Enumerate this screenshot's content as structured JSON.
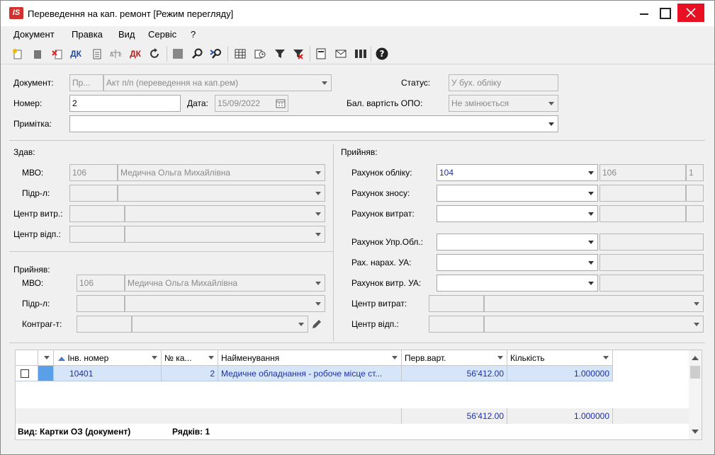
{
  "window": {
    "title": "Переведення на кап. ремонт [Режим перегляду]",
    "app_icon": "IS"
  },
  "menu": [
    "Документ",
    "Правка",
    "Вид",
    "Сервіс",
    "?"
  ],
  "form": {
    "document_label": "Документ:",
    "document_code": "Пр...",
    "document_type": "Акт п/п (переведення на кап.рем)",
    "status_label": "Статус:",
    "status_value": "У бух. обліку",
    "number_label": "Номер:",
    "number_value": "2",
    "date_label": "Дата:",
    "date_value": "15/09/2022",
    "balance_label": "Бал. вартість ОПО:",
    "balance_value": "Не змінюється",
    "note_label": "Примітка:",
    "note_value": ""
  },
  "gave": {
    "title": "Здав:",
    "mvo_label": "МВО:",
    "mvo_code": "106",
    "mvo_name": "Медична Ольга Михайлівна",
    "subdiv_label": "Підр-л:",
    "cost_center_label": "Центр витр.:",
    "resp_center_label": "Центр відп.:"
  },
  "received_left": {
    "title": "Прийняв:",
    "mvo_label": "МВО:",
    "mvo_code": "106",
    "mvo_name": "Медична Ольга Михайлівна",
    "subdiv_label": "Підр-л:",
    "contractor_label": "Контраг-т:"
  },
  "received_right": {
    "title": "Прийняв:",
    "account_label": "Рахунок обліку:",
    "account_value": "104",
    "account_code": "106",
    "account_num": "1",
    "wear_label": "Рахунок зносу:",
    "expense_label": "Рахунок витрат:",
    "mgmt_label": "Рахунок Упр.Обл.:",
    "accrual_label": "Рах. нарах. УА:",
    "exp_ua_label": "Рахунок витр. УА:",
    "cost_center_label": "Центр витрат:",
    "resp_center_label": "Центр відп.:"
  },
  "grid": {
    "columns": [
      "Інв. номер",
      "№ ка...",
      "Найменування",
      "Перв.варт.",
      "Кількість"
    ],
    "rows": [
      {
        "inv": "10401",
        "num": "2",
        "name": "Медичне обладнання - робоче місце ст...",
        "cost": "56'412.00",
        "qty": "1.000000"
      }
    ],
    "total_cost": "56'412.00",
    "total_qty": "1.000000",
    "view_label": "Вид: Картки ОЗ (документ)",
    "rows_label": "Рядків: 1"
  }
}
